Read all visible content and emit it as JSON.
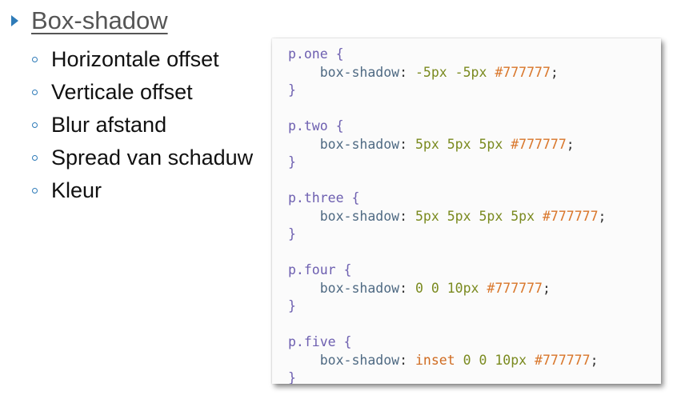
{
  "slide": {
    "heading": "Box-shadow",
    "bullets": [
      "Horizontale offset",
      "Verticale offset",
      "Blur afstand",
      "Spread van schaduw",
      "Kleur"
    ]
  },
  "code": {
    "indent": "    ",
    "blocks": [
      {
        "selector": "p.one",
        "property": "box-shadow",
        "values": [
          "-5px",
          "-5px"
        ],
        "color": "#777777"
      },
      {
        "selector": "p.two",
        "property": "box-shadow",
        "values": [
          "5px",
          "5px",
          "5px"
        ],
        "color": "#777777"
      },
      {
        "selector": "p.three",
        "property": "box-shadow",
        "values": [
          "5px",
          "5px",
          "5px",
          "5px"
        ],
        "color": "#777777"
      },
      {
        "selector": "p.four",
        "property": "box-shadow",
        "values": [
          "0",
          "0",
          "10px"
        ],
        "color": "#777777"
      },
      {
        "selector": "p.five",
        "property": "box-shadow",
        "values": [
          "inset",
          "0",
          "0",
          "10px"
        ],
        "color": "#777777"
      }
    ]
  },
  "colors": {
    "accent": "#2e7bb8",
    "heading": "#555555"
  }
}
